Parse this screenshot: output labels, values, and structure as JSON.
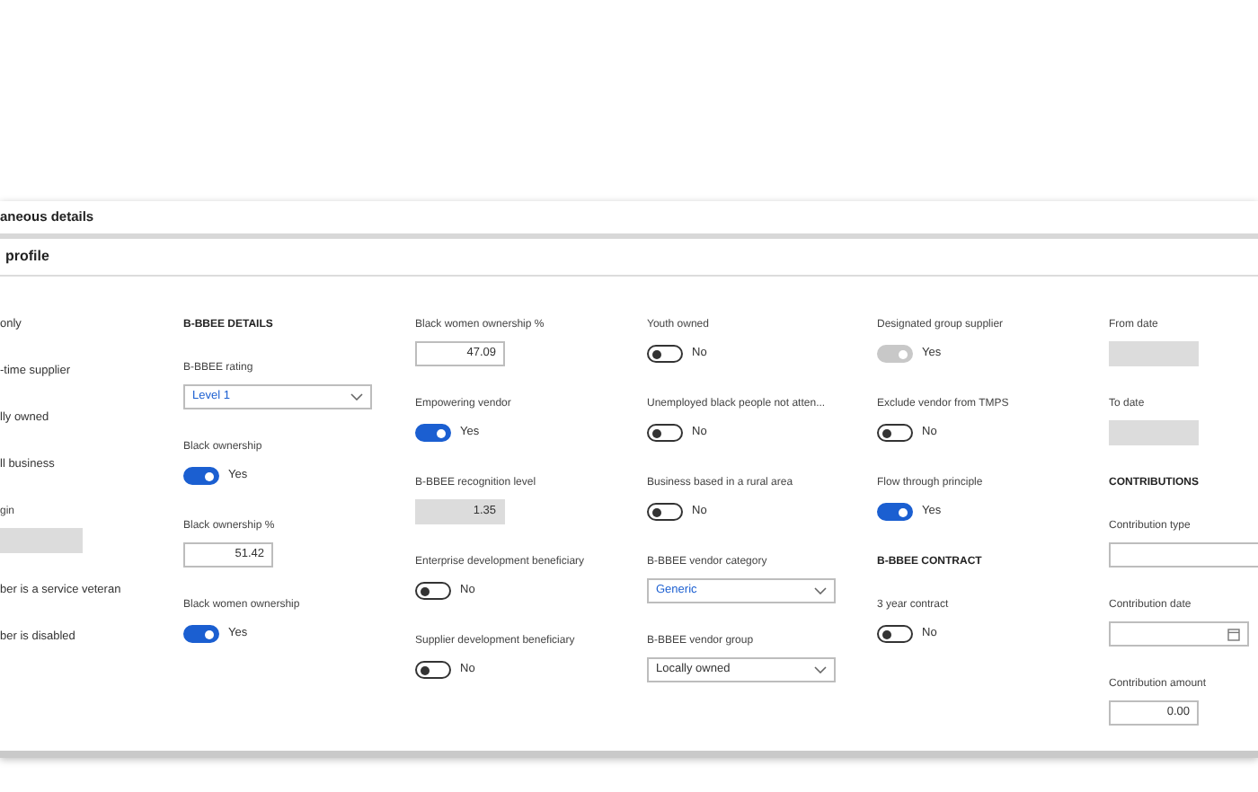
{
  "sections": [
    {
      "title": "aneous details"
    },
    {
      "title": "profile"
    }
  ],
  "columns": [
    {
      "fields": [
        {
          "kind": "text",
          "label": "only"
        },
        {
          "kind": "text",
          "label": "-time supplier"
        },
        {
          "kind": "text",
          "label": "lly owned"
        },
        {
          "kind": "text",
          "label": "ll business"
        },
        {
          "kind": "readonly",
          "label": "gin"
        },
        {
          "kind": "text",
          "label": "ber is a service veteran"
        },
        {
          "kind": "text",
          "label": "ber is disabled"
        }
      ]
    },
    {
      "fields": [
        {
          "kind": "heading",
          "label": "B-BBEE DETAILS"
        },
        {
          "kind": "select",
          "label": "B-BBEE rating",
          "value": "Level 1",
          "highlighted": true
        },
        {
          "kind": "toggle",
          "label": "Black ownership",
          "on": true,
          "disabled": false,
          "value_text": "Yes"
        },
        {
          "kind": "number",
          "label": "Black ownership %",
          "value": "51.42"
        },
        {
          "kind": "toggle",
          "label": "Black women ownership",
          "on": true,
          "disabled": false,
          "value_text": "Yes"
        }
      ]
    },
    {
      "fields": [
        {
          "kind": "number",
          "label": "Black women ownership %",
          "value": "47.09"
        },
        {
          "kind": "toggle",
          "label": "Empowering vendor",
          "on": true,
          "disabled": false,
          "value_text": "Yes"
        },
        {
          "kind": "readonly",
          "label": "B-BBEE recognition level",
          "value": "1.35"
        },
        {
          "kind": "toggle",
          "label": "Enterprise development beneficiary",
          "on": false,
          "disabled": false,
          "value_text": "No"
        },
        {
          "kind": "toggle",
          "label": "Supplier development beneficiary",
          "on": false,
          "disabled": false,
          "value_text": "No"
        }
      ]
    },
    {
      "fields": [
        {
          "kind": "toggle",
          "label": "Youth owned",
          "on": false,
          "disabled": false,
          "value_text": "No"
        },
        {
          "kind": "toggle",
          "label": "Unemployed black people not atten...",
          "on": false,
          "disabled": false,
          "value_text": "No"
        },
        {
          "kind": "toggle",
          "label": "Business based in a rural area",
          "on": false,
          "disabled": false,
          "value_text": "No"
        },
        {
          "kind": "select",
          "label": "B-BBEE vendor category",
          "value": "Generic",
          "highlighted": true
        },
        {
          "kind": "select",
          "label": "B-BBEE vendor group",
          "value": "Locally owned",
          "highlighted": false
        }
      ]
    },
    {
      "fields": [
        {
          "kind": "toggle",
          "label": "Designated group supplier",
          "on": true,
          "disabled": true,
          "value_text": "Yes"
        },
        {
          "kind": "toggle",
          "label": "Exclude vendor from TMPS",
          "on": false,
          "disabled": false,
          "value_text": "No"
        },
        {
          "kind": "toggle",
          "label": "Flow through principle",
          "on": true,
          "disabled": false,
          "value_text": "Yes"
        },
        {
          "kind": "heading",
          "label": "B-BBEE CONTRACT"
        },
        {
          "kind": "toggle",
          "label": "3 year contract",
          "on": false,
          "disabled": false,
          "value_text": "No"
        }
      ]
    },
    {
      "fields": [
        {
          "kind": "readonly",
          "label": "From date"
        },
        {
          "kind": "readonly",
          "label": "To date"
        },
        {
          "kind": "heading",
          "label": "CONTRIBUTIONS"
        },
        {
          "kind": "input",
          "label": "Contribution type"
        },
        {
          "kind": "date",
          "label": "Contribution date"
        },
        {
          "kind": "number",
          "label": "Contribution amount",
          "value": "0.00"
        }
      ]
    }
  ]
}
